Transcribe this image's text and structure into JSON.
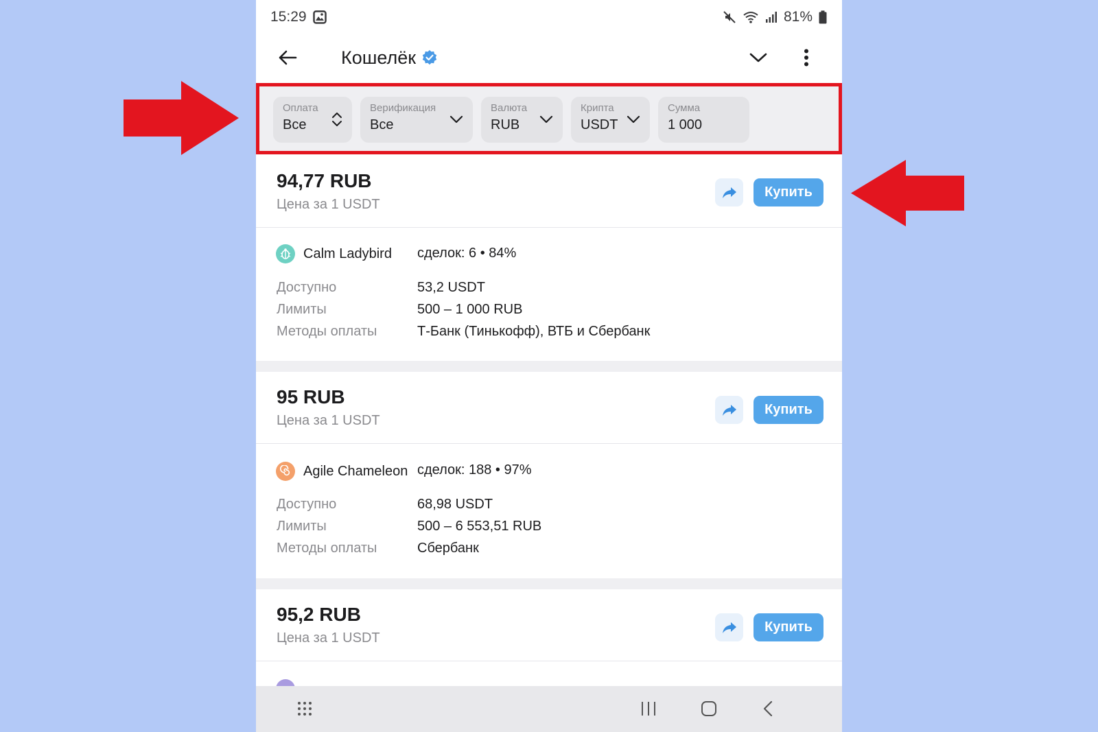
{
  "status_bar": {
    "time": "15:29",
    "battery": "81%"
  },
  "header": {
    "title": "Кошелёк"
  },
  "filters": [
    {
      "label": "Оплата",
      "value": "Все"
    },
    {
      "label": "Верификация",
      "value": "Все"
    },
    {
      "label": "Валюта",
      "value": "RUB"
    },
    {
      "label": "Крипта",
      "value": "USDT"
    },
    {
      "label": "Сумма",
      "value": "1 000"
    }
  ],
  "buy_label": "Купить",
  "row_labels": {
    "available": "Доступно",
    "limits": "Лимиты",
    "methods": "Методы оплаты"
  },
  "offers": [
    {
      "price": "94,77 RUB",
      "per": "Цена за 1 USDT",
      "seller": "Calm Ladybird",
      "deals": "сделок: 6 • 84%",
      "available": "53,2 USDT",
      "limits": "500 – 1 000 RUB",
      "methods": "Т-Банк (Тинькофф), ВТБ и Сбербанк"
    },
    {
      "price": "95 RUB",
      "per": "Цена за 1 USDT",
      "seller": "Agile Chameleon",
      "deals": "сделок: 188 • 97%",
      "available": "68,98 USDT",
      "limits": "500 – 6 553,51 RUB",
      "methods": "Сбербанк"
    },
    {
      "price": "95,2 RUB",
      "per": "Цена за 1 USDT"
    }
  ],
  "colors": {
    "accent": "#54a6ea",
    "highlight_red": "#e3151f",
    "page_background": "#b3c9f7"
  }
}
